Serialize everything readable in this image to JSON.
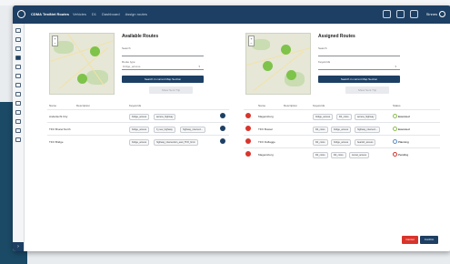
{
  "app": {
    "brand": "CDMA TestNet Routes"
  },
  "breadcrumbs": [
    "Vehicles",
    "D1",
    "Dashboard",
    "Assign routes"
  ],
  "user": {
    "name": "Sinnes"
  },
  "available": {
    "title": "Available Routes",
    "search_label": "Search",
    "filter_label": "Route type",
    "filter_value": "bridge_access",
    "search_button": "Search in current Map Section",
    "show_all_button": "Show Sent Trip",
    "columns": [
      "Name",
      "Description",
      "Keywords"
    ],
    "rows": [
      {
        "name": "Anderlecht City",
        "keywords": [
          "bridge_access",
          "access_highway"
        ]
      },
      {
        "name": "TFO Brucel North",
        "keywords": [
          "bridge_access",
          "fl_new_highway",
          "highway_intersect..."
        ]
      },
      {
        "name": "TFO Bridge",
        "keywords": [
          "bridge_access",
          "highway_intersection_east_TFO_hmm"
        ]
      }
    ]
  },
  "assigned": {
    "title": "Assigned Routes",
    "search_label": "Search",
    "filter_label": "Keywords",
    "search_button": "Search in current Map Section",
    "show_all_button": "Show Sent Trip",
    "columns": [
      "Name",
      "Description",
      "Keywords",
      "Status"
    ],
    "rows": [
      {
        "name": "Magensburg",
        "keywords": [
          "bridge_access",
          "D2_cross",
          "access_highway"
        ],
        "status": "Executed",
        "status_color": "#8cc04b"
      },
      {
        "name": "TFO Bussel",
        "keywords": [
          "D2_cross",
          "bridge_access",
          "highway_intersect..."
        ],
        "status": "Executed",
        "status_color": "#8cc04b"
      },
      {
        "name": "TFO Duflagge",
        "keywords": [
          "D2_cross",
          "bridge_access",
          "bearish_access"
        ],
        "status": "Planning",
        "status_color": "#5a8dc8"
      },
      {
        "name": "Magensburg",
        "keywords": [
          "D2_cross",
          "D2_cross",
          "tunnel_access"
        ],
        "status": "Pending",
        "status_color": "#d9342b"
      }
    ]
  },
  "footer": {
    "cancel": "Cancel",
    "confirm": "Confirm"
  },
  "colors": {
    "topbar": "#1d3f63",
    "accent": "#1d3f63",
    "danger": "#d9342b",
    "success": "#8cc04b"
  },
  "icons": [
    "logo-icon",
    "settings-icon",
    "calendar-icon",
    "bell-icon",
    "user-icon"
  ]
}
